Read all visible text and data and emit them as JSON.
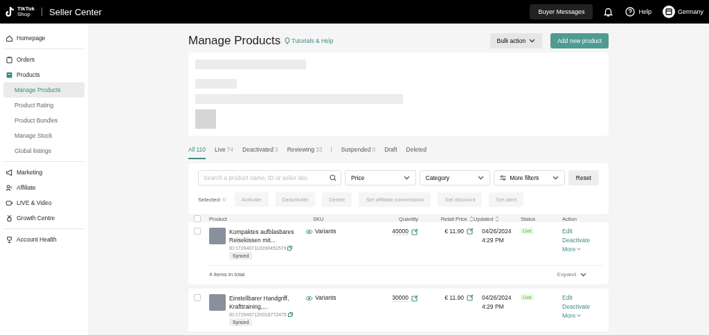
{
  "topbar": {
    "logo_line_1": "TikTok",
    "logo_line_2": "Shop",
    "title": "Seller Center",
    "buyer_messages": "Buyer Messages",
    "help": "Help",
    "region": "Germany"
  },
  "sidebar": {
    "sections": [
      {
        "items": [
          {
            "label": "Homepage",
            "selected": false
          }
        ]
      },
      {
        "items": [
          {
            "label": "Orders",
            "selected": false
          },
          {
            "label": "Products",
            "selected": false,
            "children": [
              {
                "label": "Manage Products",
                "selected": true
              },
              {
                "label": "Product Rating",
                "selected": false
              },
              {
                "label": "Product Bundles",
                "selected": false
              },
              {
                "label": "Manage Stock",
                "selected": false
              },
              {
                "label": "Global listings",
                "selected": false
              }
            ]
          }
        ]
      },
      {
        "items": [
          {
            "label": "Marketing",
            "selected": false
          },
          {
            "label": "Affiliate",
            "selected": false
          },
          {
            "label": "LIVE & Video",
            "selected": false
          },
          {
            "label": "Growth Centre",
            "selected": false
          }
        ]
      },
      {
        "items": [
          {
            "label": "Account Health",
            "selected": false
          }
        ]
      }
    ]
  },
  "header": {
    "title": "Manage Products",
    "help_link": "Tutorials & Help",
    "bulk_action": "Bulk action",
    "add_button": "Add new product"
  },
  "tabs": [
    {
      "kind": "tab",
      "label": "All",
      "count": "110",
      "selected": true
    },
    {
      "kind": "tab",
      "label": "Live",
      "count": "74",
      "selected": false
    },
    {
      "kind": "tab",
      "label": "Deactivated",
      "count": "3",
      "selected": false
    },
    {
      "kind": "tab",
      "label": "Reviewing",
      "count": "33",
      "selected": false
    },
    {
      "kind": "divider"
    },
    {
      "kind": "tab",
      "label": "Suspended",
      "count": "0",
      "selected": false
    },
    {
      "kind": "tab",
      "label": "Draft",
      "selected": false
    },
    {
      "kind": "tab",
      "label": "Deleted",
      "selected": false
    }
  ],
  "filters": {
    "search": {
      "placeholder": "Search a product name, ID or seller sku"
    },
    "dropdowns": [
      {
        "label": "Price",
        "kind": "plain"
      },
      {
        "label": "Category",
        "kind": "plain"
      },
      {
        "label": "More filters",
        "kind": "filters"
      }
    ],
    "reset": "Reset",
    "selected_label": "Selected:",
    "selected_count": "0",
    "bulk_buttons": [
      {
        "label": "Activate",
        "disabled": true
      },
      {
        "label": "Deactivate",
        "disabled": true
      },
      {
        "label": "Delete",
        "disabled": true
      },
      {
        "label": "Set affiliate commission",
        "disabled": true
      },
      {
        "label": "Set discount",
        "disabled": true
      },
      {
        "label": "Set alert",
        "disabled": true
      }
    ]
  },
  "table": {
    "select_all_checked": false,
    "columns": [
      {
        "label": "Product",
        "sortable": false
      },
      {
        "label": "SKU",
        "sortable": false
      },
      {
        "label": "Quantity",
        "sortable": false
      },
      {
        "label": "Retail Price",
        "sortable": true
      },
      {
        "label": "Updated",
        "sortable": true
      },
      {
        "label": "Status",
        "sortable": false
      },
      {
        "label": "Action",
        "sortable": false
      }
    ],
    "rows": [
      {
        "checked": false,
        "name": "Kompaktes aufblasbares Reisekissen mit...",
        "id": "ID:1729407110390451579",
        "tag": "Synced",
        "sku": "Variants",
        "quantity": "40000",
        "price": "€ 11.90",
        "updated_date": "04/26/2024",
        "updated_time": "4:29 PM",
        "status": "Live",
        "actions": [
          "Edit",
          "Deactivate",
          "More"
        ],
        "footer": {
          "total": "4 items in total",
          "expand": "Expand"
        }
      },
      {
        "checked": false,
        "name": "Einstellbarer Handgriff, Krafttraining,...",
        "id": "ID:1729407120016772475",
        "tag": "Synced",
        "sku": "Variants",
        "quantity": "30000",
        "price": "€ 11.90",
        "updated_date": "04/26/2024",
        "updated_time": "4:29 PM",
        "status": "Live",
        "actions": [
          "Edit",
          "Deactivate",
          "More"
        ]
      }
    ]
  }
}
